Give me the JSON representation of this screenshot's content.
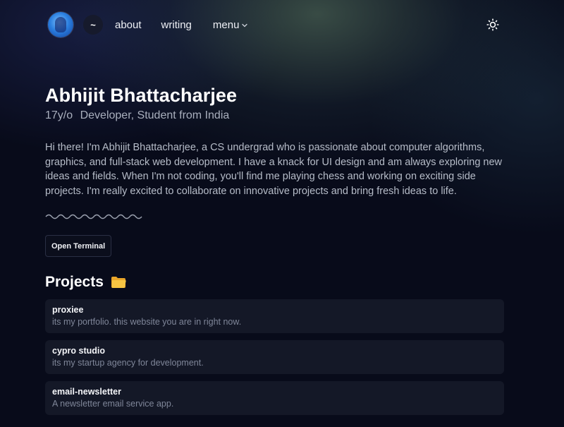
{
  "nav": {
    "home_label": "~",
    "links": [
      "about",
      "writing",
      "menu"
    ],
    "menu_chevron": "⌄",
    "theme_icon": "sun-icon"
  },
  "profile": {
    "name": "Abhijit Bhattacharjee",
    "age": "17y/o",
    "role": "Developer, Student from India",
    "bio": "Hi there! I'm Abhijit Bhattacharjee, a CS undergrad who is passionate about computer algorithms, graphics, and full-stack web development. I have a knack for UI design and am always exploring new ideas and fields. When I'm not coding, you'll find me playing chess and working on exciting side projects. I'm really excited to collaborate on innovative projects and bring fresh ideas to life."
  },
  "actions": {
    "terminal_label": "Open Terminal"
  },
  "projects": {
    "title": "Projects",
    "icon": "folder-icon",
    "items": [
      {
        "name": "proxiee",
        "description": "its my portfolio. this website you are in right now."
      },
      {
        "name": "cypro studio",
        "description": "its my startup agency for development."
      },
      {
        "name": "email-newsletter",
        "description": "A newsletter email service app."
      }
    ]
  },
  "colors": {
    "background": "#080b1a",
    "card": "#141827",
    "accent_folder": "#f6c443"
  }
}
